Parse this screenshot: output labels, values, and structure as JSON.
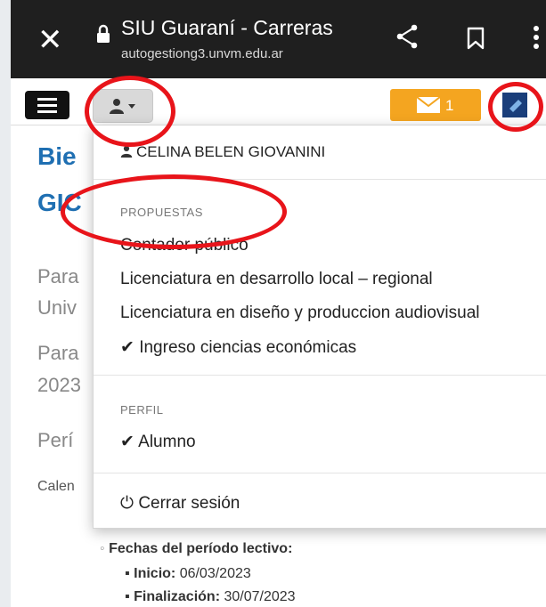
{
  "browser": {
    "title": "SIU Guaraní - Carreras",
    "url": "autogestiong3.unvm.edu.ar"
  },
  "appbar": {
    "mail_count": "1"
  },
  "background": {
    "heading_line1": "Bie",
    "heading_line2": "GIC",
    "line1": "Para",
    "line2": "Univ",
    "line3": "Para",
    "line4": "2023",
    "line5": "Perí",
    "line6": "Calen"
  },
  "menu": {
    "user_name": "CELINA BELEN GIOVANINI",
    "propuestas_header": "PROPUESTAS",
    "propuestas": [
      "Contador público",
      "Licenciatura en desarrollo local – regional",
      "Licenciatura en diseño y produccion audiovisual",
      "Ingreso ciencias económicas"
    ],
    "perfil_header": "PERFIL",
    "perfil_item": "Alumno",
    "logout": "Cerrar sesión"
  },
  "details": {
    "fechas_label": "Fechas del período lectivo:",
    "inicio_label": "Inicio:",
    "inicio_value": "06/03/2023",
    "fin_label": "Finalización:",
    "fin_value": "30/07/2023"
  },
  "colors": {
    "accent_mail": "#f4a520",
    "heading_blue": "#1f6fb2",
    "annotation_red": "#e8141a"
  }
}
